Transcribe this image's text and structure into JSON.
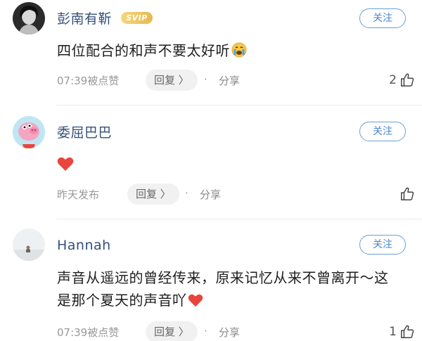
{
  "comments": [
    {
      "username": "彭南有靳",
      "badge": "SVIP",
      "follow_label": "关注",
      "text": "四位配合的和声不要太好听",
      "emoji": "crying-face-icon",
      "meta": "07:39被点赞",
      "reply_label": "回复 〉",
      "dot": "·",
      "share_label": "分享",
      "likes": "2"
    },
    {
      "username": "委屈巴巴",
      "follow_label": "关注",
      "text": "",
      "emoji": "red-heart-icon",
      "meta": "昨天发布",
      "reply_label": "回复 〉",
      "dot": "·",
      "share_label": "分享",
      "likes": ""
    },
    {
      "username": "Hannah",
      "follow_label": "关注",
      "text_line1": "声音从遥远的曾经传来，原来记忆从来不曾离开～这",
      "text_line2": "是那个夏天的声音吖",
      "emoji": "red-heart-icon",
      "meta": "07:39被点赞",
      "reply_label": "回复 〉",
      "dot": "·",
      "share_label": "分享",
      "likes": "1"
    }
  ],
  "colors": {
    "username": "#33507a",
    "follow": "#4a86cf",
    "meta": "#999999",
    "heart": "#e8453c"
  }
}
